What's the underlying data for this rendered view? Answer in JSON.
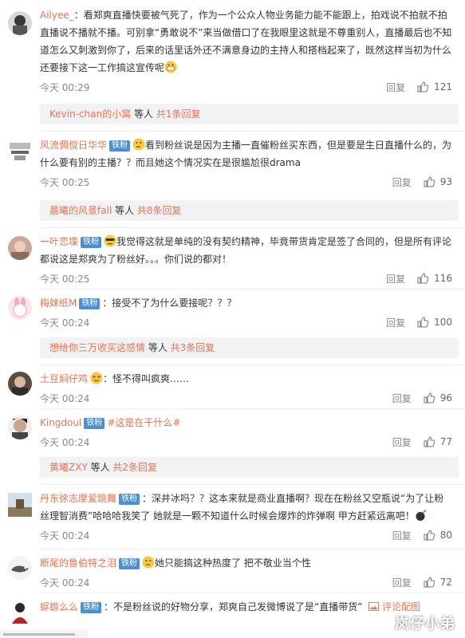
{
  "comments": [
    {
      "user": "Ailyee_",
      "badge": "",
      "text": "：看郑爽直播快要被气死了，作为一个公众人物业务能力能不能跟上，拍戏说不拍就不拍直播说不播就不播。可别拿“勇敢说不”来当做借口了在我眼里这就是不尊重别人，直播最后也不知道怎么又刺激到你了，后来的话里话外还不满意身边的主持人和搭档起来了，既然这样当初为什么还要接下这一工作搞这宣传呢",
      "time": "今天 00:29",
      "reply": "回复",
      "likes": "121",
      "sub": {
        "who": "Kevin-chan的小窝",
        "etc": " 等人 ",
        "more": "共1条回复"
      }
    },
    {
      "user": "风流倜傥日华华",
      "badge": "铁粉",
      "text": "看到粉丝说是因为主播一直催粉丝买东西，但是要是生日直播什么的，为什么要有别的主播？？而且她这个情况实在是很尴尬很drama",
      "time": "今天 00:25",
      "reply": "回复",
      "likes": "93",
      "sub": {
        "who": "晨曦的风景fall",
        "etc": " 等人 ",
        "more": "共8条回复"
      }
    },
    {
      "user": "一叶恋堞",
      "badge": "铁粉",
      "text": "我觉得这就是单纯的没有契约精神，毕竟带货肯定是签了合同的，但是所有评论都说这是郑爽为了粉丝好。。。你们说的都对！",
      "time": "今天 00:25",
      "reply": "回复",
      "likes": "116"
    },
    {
      "user": "梅妹纸M",
      "badge": "铁粉",
      "text": "：接受不了为什么要接呢？？？",
      "time": "今天 00:24",
      "reply": "回复",
      "likes": "100",
      "sub": {
        "who": "想给你三万收买这感情",
        "etc": " 等人 ",
        "more": "共3条回复"
      }
    },
    {
      "user": "土豆焖仔鸡",
      "badge": "",
      "text": "：怪不得叫疯爽……",
      "time": "今天 00:24",
      "reply": "回复",
      "likes": "96"
    },
    {
      "user": "Kingdoul",
      "badge": "铁粉",
      "text": "#这是在干什么#",
      "time": "今天 00:24",
      "reply": "回复",
      "likes": "77",
      "sub": {
        "who": "黄曦ZXY",
        "etc": " 等人 ",
        "more": "共2条回复"
      }
    },
    {
      "user": "丹东徐志摩爱跳舞",
      "badge": "铁粉",
      "text": "：深井冰吗？？这本来就是商业直播啊？现在在粉丝又空瓶说“为了让粉丝理智消费”哈哈哈我笑了 她就是一颗不知道什么时候会爆炸的炸弹啊 甲方赶紧远离吧！",
      "time": "今天 00:24",
      "reply": "回复",
      "likes": "80"
    },
    {
      "user": "断尾的鲁伯特之泪",
      "badge": "铁粉",
      "text": "她只能搞这种热度了 把不敬业当个性",
      "time": "今天 00:24",
      "reply": "回复",
      "likes": "72"
    },
    {
      "user": "蜉蝣么么",
      "badge": "铁粉",
      "text": "：不是粉丝说的好物分享，郑爽自己发微博说了是“直播带货”",
      "comment_pic": "评论配图"
    }
  ],
  "watermark": "岚仔小弟"
}
